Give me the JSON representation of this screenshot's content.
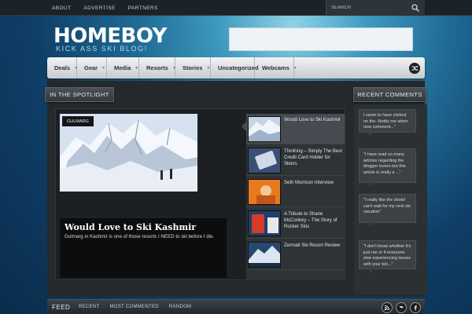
{
  "topbar": {
    "links": [
      "ABOUT",
      "ADVERTISE",
      "PARTNERS"
    ],
    "search_placeholder": "SEARCH"
  },
  "site": {
    "title": "HOMEBOY",
    "tagline": "KICK ASS SKI BLOG!"
  },
  "main_nav": {
    "items": [
      "Deals",
      "Gear",
      "Media",
      "Resorts",
      "Stories",
      "Uncategorized",
      "Webcams"
    ]
  },
  "spotlight": {
    "heading": "IN THE SPOTLIGHT",
    "featured": {
      "tag": "GULMARG",
      "title": "Would Love to Ski Kashmir",
      "excerpt": "Gulmarg in Kashmir is one of those resorts I NEED to ski before I die."
    },
    "list": [
      {
        "title": "Would Love to Ski Kashmir"
      },
      {
        "title": "ThinKing – Simply The Best Credit Card Holder for Skiers"
      },
      {
        "title": "Seth Morrison Interview"
      },
      {
        "title": "A Tribute to Shane McConkey – The Story of Rocker Skis"
      },
      {
        "title": "Zermatt Ski Resort Review"
      }
    ]
  },
  "recent_comments": {
    "heading": "RECENT COMMENTS",
    "items": [
      "I seem to have clicked on the -Notify me when new comment...\"",
      "\"I have read so many articles regarding the blogger lovers but this article is really a ...\"",
      "\"I really like the shots! can't wait for my next ski vacation\"",
      "\"I don't know whether it's just me or if everyone else experiencing issues with your blo...\""
    ]
  },
  "footer": {
    "label": "FEED",
    "tabs": [
      "RECENT",
      "MOST COMMENTED",
      "RANDOM"
    ]
  },
  "colors": {
    "accent": "#a7dff2",
    "panel": "#25292c",
    "nav_bg": "#e4e6e8"
  },
  "icons": [
    "search-icon",
    "shuffle-icon",
    "dropdown-arrow-icon",
    "rss-icon",
    "twitter-icon",
    "facebook-icon"
  ]
}
